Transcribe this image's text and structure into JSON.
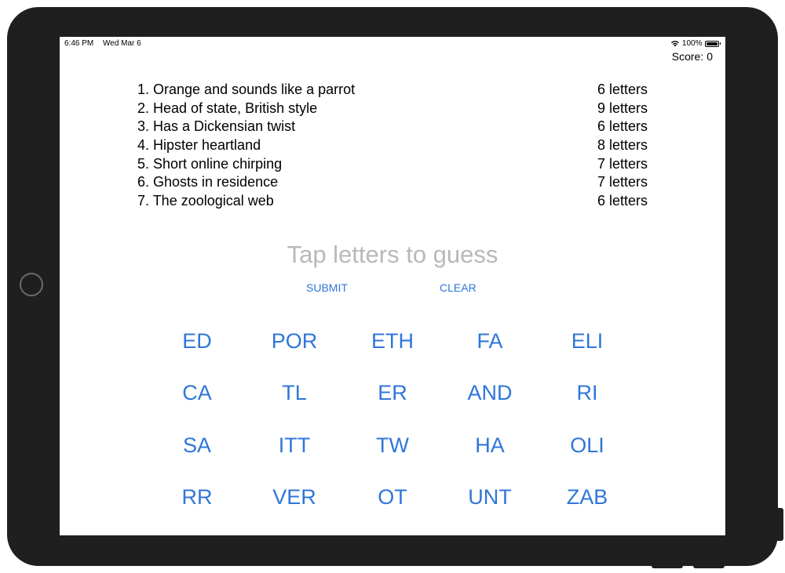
{
  "status_bar": {
    "time": "6:46 PM",
    "date": "Wed Mar 6",
    "battery_percent": "100%",
    "battery_level": 1.0,
    "wifi_icon": "wifi-icon",
    "battery_icon": "battery-icon"
  },
  "score": {
    "label": "Score:",
    "value": "0"
  },
  "clues": [
    {
      "text": "1. Orange and sounds like a parrot",
      "length": "6 letters"
    },
    {
      "text": "2. Head of state, British style",
      "length": "9 letters"
    },
    {
      "text": "3. Has a Dickensian twist",
      "length": "6 letters"
    },
    {
      "text": "4. Hipster heartland",
      "length": "8 letters"
    },
    {
      "text": "5. Short online chirping",
      "length": "7 letters"
    },
    {
      "text": "6. Ghosts in residence",
      "length": "7 letters"
    },
    {
      "text": "7. The zoological web",
      "length": "6 letters"
    }
  ],
  "guess": {
    "placeholder": "Tap letters to guess"
  },
  "actions": {
    "submit_label": "SUBMIT",
    "clear_label": "CLEAR"
  },
  "tiles": [
    [
      "ED",
      "POR",
      "ETH",
      "FA",
      "ELI"
    ],
    [
      "CA",
      "TL",
      "ER",
      "AND",
      "RI"
    ],
    [
      "SA",
      "ITT",
      "TW",
      "HA",
      "OLI"
    ],
    [
      "RR",
      "VER",
      "OT",
      "UNT",
      "ZAB"
    ]
  ],
  "colors": {
    "accent": "#2f76d9",
    "placeholder": "#b8b8bd",
    "bezel": "#1f1f1f"
  }
}
